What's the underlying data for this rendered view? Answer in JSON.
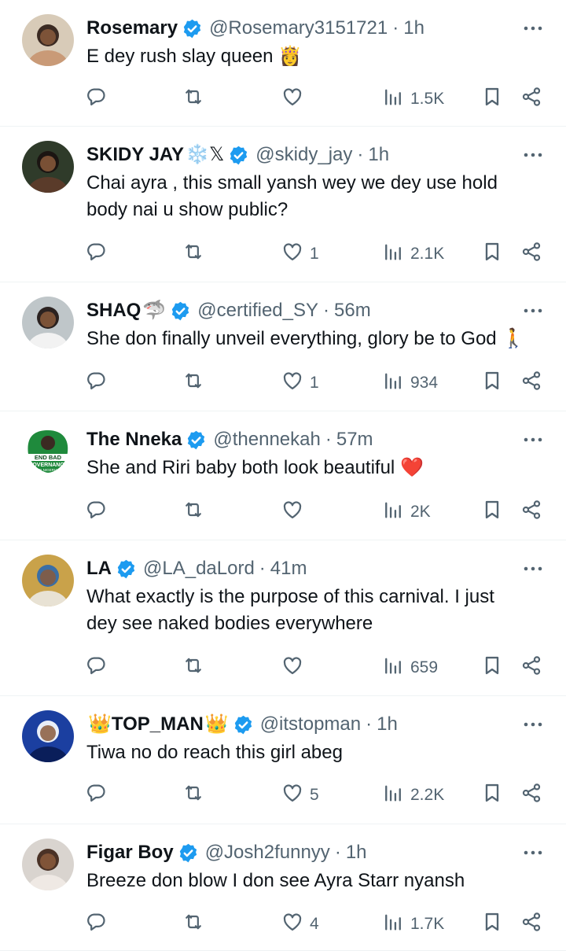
{
  "tweets": [
    {
      "name": "Rosemary",
      "name_prefix_emoji": "",
      "name_suffix_emoji": "",
      "handle": "@Rosemary3151721",
      "time": "1h",
      "lines": [
        "E dey rush slay queen"
      ],
      "text_emoji": "👸",
      "replies": "",
      "retweets": "",
      "likes": "",
      "views": "1.5K",
      "avatar_colors": [
        "#d8cbb8",
        "#3b2a22",
        "#c99a77"
      ]
    },
    {
      "name": "SKIDY JAY",
      "name_prefix_emoji": "",
      "name_suffix_emoji": "❄️𝕏",
      "handle": "@skidy_jay",
      "time": "1h",
      "lines": [
        "Chai ayra , this small yansh wey we dey use hold",
        "body nai u show public?"
      ],
      "text_emoji": "",
      "replies": "",
      "retweets": "",
      "likes": "1",
      "views": "2.1K",
      "avatar_colors": [
        "#2f3b2a",
        "#1b1512",
        "#5a3b2a"
      ]
    },
    {
      "name": "SHAQ",
      "name_prefix_emoji": "",
      "name_suffix_emoji": "🦈",
      "handle": "@certified_SY",
      "time": "56m",
      "lines": [
        "She don finally unveil everything, glory be to God"
      ],
      "text_emoji": "🚶",
      "replies": "",
      "retweets": "",
      "likes": "1",
      "views": "934",
      "avatar_colors": [
        "#bfc6c9",
        "#2b2220",
        "#f2f2f2"
      ]
    },
    {
      "name": "The Nneka",
      "name_prefix_emoji": "",
      "name_suffix_emoji": "",
      "handle": "@thennekah",
      "time": "57m",
      "lines": [
        "She and Riri baby both look beautiful"
      ],
      "text_emoji": "❤️",
      "replies": "",
      "retweets": "",
      "likes": "",
      "views": "2K",
      "avatar_colors": [
        "#1f8a3c",
        "#ffffff",
        "#0f4d20"
      ],
      "avatar_text": [
        "END BAD",
        "GOVERNANCE",
        "IN NIGERIA"
      ]
    },
    {
      "name": "LA",
      "name_prefix_emoji": "",
      "name_suffix_emoji": "",
      "handle": "@LA_daLord",
      "time": "41m",
      "lines": [
        "What exactly is the purpose of this carnival. I just",
        "dey see naked bodies everywhere"
      ],
      "text_emoji": "",
      "replies": "",
      "retweets": "",
      "likes": "",
      "views": "659",
      "avatar_colors": [
        "#c9a24a",
        "#3a6ea5",
        "#e8e2d4"
      ]
    },
    {
      "name": "TOP_MAN",
      "name_prefix_emoji": "👑",
      "name_suffix_emoji": "👑",
      "handle": "@itstopman",
      "time": "1h",
      "lines": [
        "Tiwa no do reach this girl abeg"
      ],
      "text_emoji": "",
      "replies": "",
      "retweets": "",
      "likes": "5",
      "views": "2.2K",
      "avatar_colors": [
        "#1b3fa0",
        "#e8eef8",
        "#0a1e5a"
      ]
    },
    {
      "name": "Figar Boy",
      "name_prefix_emoji": "",
      "name_suffix_emoji": "",
      "handle": "@Josh2funnyy",
      "time": "1h",
      "lines": [
        "Breeze don blow I don see Ayra Starr nyansh"
      ],
      "text_emoji": "",
      "replies": "",
      "retweets": "",
      "likes": "4",
      "views": "1.7K",
      "avatar_colors": [
        "#d9d4cf",
        "#4a3226",
        "#efe9e4"
      ]
    }
  ],
  "colors": {
    "verified": "#1d9bf0",
    "muted": "#536471",
    "text": "#0f1419",
    "divider": "#eff3f4"
  },
  "icons": [
    "reply-icon",
    "retweet-icon",
    "like-icon",
    "views-icon",
    "bookmark-icon",
    "share-icon",
    "more-icon",
    "verified-icon"
  ]
}
